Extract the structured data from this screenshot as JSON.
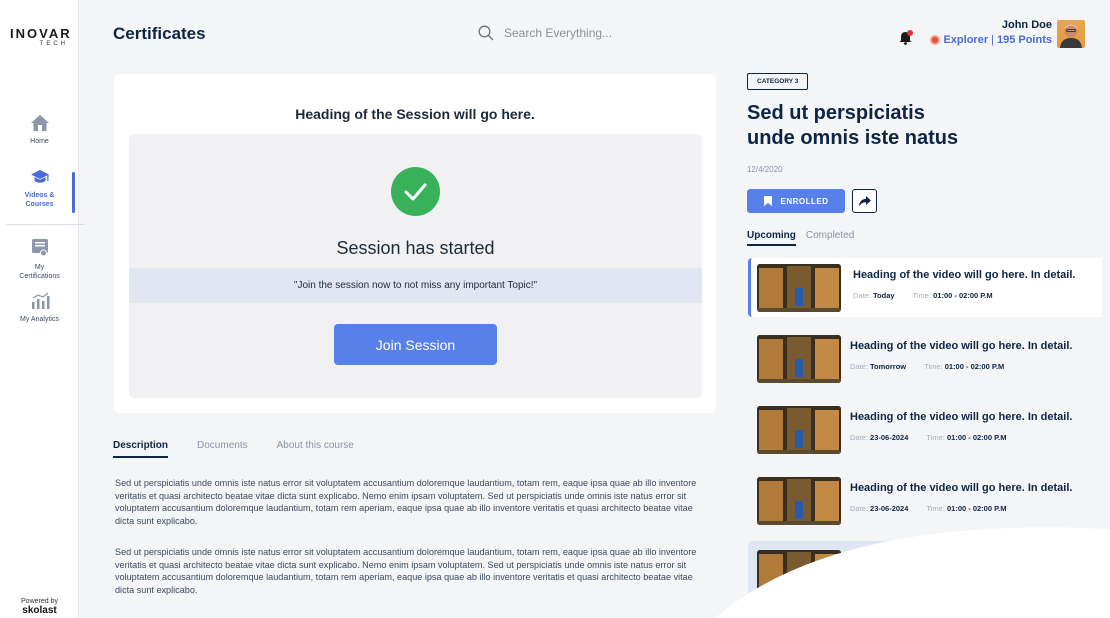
{
  "logo": {
    "main": "INOVAR",
    "sub": "TECH"
  },
  "sidebar": {
    "items": [
      {
        "label": "Home",
        "icon": "home-icon"
      },
      {
        "label": "Videos & Courses",
        "line1": "Videos &",
        "line2": "Courses",
        "icon": "graduation-cap-icon",
        "active": true
      },
      {
        "label": "My Certifications",
        "line1": "My",
        "line2": "Certifications",
        "icon": "certificate-icon"
      },
      {
        "label": "My Analytics",
        "icon": "analytics-icon"
      }
    ],
    "powered_by": "Powered by",
    "powered_logo": "skolast"
  },
  "header": {
    "title": "Certificates",
    "search_placeholder": "Search Everything...",
    "user": {
      "name": "John Doe",
      "level": "Explorer",
      "separator": "|",
      "points": "195 Points"
    }
  },
  "session": {
    "heading": "Heading of the Session will go here.",
    "status": "Session has started",
    "banner": "\"Join the session now to not miss any important Topic!\"",
    "join_label": "Join Session"
  },
  "tabs": [
    {
      "label": "Description",
      "active": true
    },
    {
      "label": "Documents"
    },
    {
      "label": "About this course"
    }
  ],
  "description": [
    "Sed ut perspiciatis unde omnis iste natus error sit voluptatem accusantium doloremque laudantium, totam rem, eaque ipsa quae ab illo inventore veritatis et quasi architecto beatae vitae dicta sunt explicabo. Nemo enim ipsam voluptatem. Sed ut perspiciatis unde omnis iste natus error sit voluptatem accusantium doloremque laudantium, totam rem aperiam, eaque ipsa quae ab illo inventore veritatis et quasi architecto beatae vitae dicta sunt explicabo.",
    "Sed ut perspiciatis unde omnis iste natus error sit voluptatem accusantium doloremque laudantium, totam rem, eaque ipsa quae ab illo inventore veritatis et quasi architecto beatae vitae dicta sunt explicabo. Nemo enim ipsam voluptatem. Sed ut perspiciatis unde omnis iste natus error sit voluptatem accusantium doloremque laudantium, totam rem aperiam, eaque ipsa quae ab illo inventore veritatis et quasi architecto beatae vitae dicta sunt explicabo."
  ],
  "course": {
    "category": "CATEGORY 3",
    "title_line1": "Sed ut perspiciatis",
    "title_line2": "unde omnis iste natus",
    "date": "12/4/2020",
    "enrolled_label": "ENROLLED"
  },
  "video_tabs": [
    {
      "label": "Upcoming",
      "active": true
    },
    {
      "label": "Completed"
    }
  ],
  "videos": [
    {
      "title": "Heading of the video will go here. In detail.",
      "date_label": "Date:",
      "date": "Today",
      "time_label": "Time:",
      "time": "01:00 - 02:00 P.M",
      "active": true
    },
    {
      "title": "Heading of the video will go here. In detail.",
      "date_label": "Date:",
      "date": "Tomorrow",
      "time_label": "Time:",
      "time": "01:00 - 02:00 P.M"
    },
    {
      "title": "Heading of the video will go here. In detail.",
      "date_label": "Date:",
      "date": "23-06-2024",
      "time_label": "Time:",
      "time": "01:00 - 02:00 P.M"
    },
    {
      "title": "Heading of the video will go here. In detail.",
      "date_label": "Date:",
      "date": "23-06-2024",
      "time_label": "Time:",
      "time": "01:00 - 02:00 P.M"
    }
  ],
  "colors": {
    "accent": "#5880e9",
    "navy": "#0d2545",
    "success": "#39b15a",
    "background": "#f4f5f7"
  }
}
